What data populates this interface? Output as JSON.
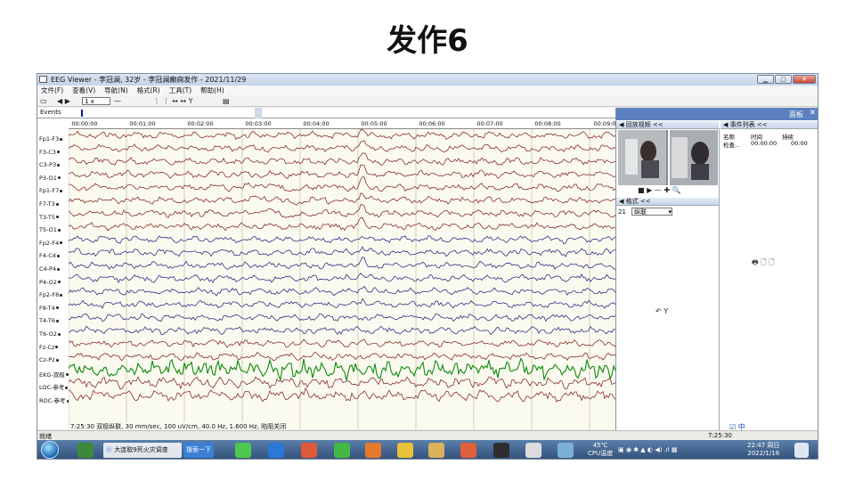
{
  "slide": {
    "title": "发作6"
  },
  "window": {
    "title": "EEG Viewer - 李冠澜, 32岁 - 李冠澜癫痫发作 - 2021/11/29",
    "menu": [
      "文件(F)",
      "查看(V)",
      "导航(N)",
      "格式(R)",
      "工具(T)",
      "帮助(H)"
    ],
    "toolbar": {
      "speed": "1 x",
      "icons": "◀ ▶",
      "tools": "⋮ ⋮ ↔ ↔ Y"
    }
  },
  "events_label": "Events",
  "time_ticks": [
    "00:00:00",
    "00:01:00",
    "00:02:00",
    "00:03:00",
    "00:04:00",
    "00:05:00",
    "00:06:00",
    "00:07:00",
    "00:08:00",
    "00:09:0"
  ],
  "channels": [
    "Fp1-F3",
    "F3-C3",
    "C3-P3",
    "P3-O1",
    "Fp1-F7",
    "F7-T3",
    "T3-T5",
    "T5-O1",
    "Fp2-F4",
    "F4-C4",
    "C4-P4",
    "P4-O2",
    "Fp2-F8",
    "F8-T4",
    "T4-T6",
    "T6-O2",
    "Fz-Cz",
    "Cz-Pz",
    "EKG-双极",
    "LOC-参考",
    "ROC-参考"
  ],
  "trace_info": "7:25:30 双极纵联, 30 mm/sec, 100 uV/cm, 40.0 Hz, 1.600 Hz, 陷阻关闭",
  "right_panel": {
    "header": "面板",
    "close": "✕",
    "video_section": "回放视频 <<",
    "video_controls": "■  ▶  —  ✚  🔍",
    "format_section": "格式 <<",
    "format_number": "21",
    "format_value": "纵联",
    "events_section": "事件列表 <<",
    "event_columns": [
      "名称",
      "时间",
      "持续"
    ],
    "event_row": [
      "检查...",
      "00:00:00",
      "00:00"
    ],
    "icons": "🖶 🗋 🗋",
    "undo": "↶  Y",
    "bottom_icons": "☑ 中"
  },
  "status": {
    "left": "就绪",
    "right": "7:25:30"
  },
  "taskbar": {
    "search_text": "大连取9死火灾调查",
    "search_button": "搜索一下",
    "cpu_temp": "45℃",
    "cpu_label": "CPU温度",
    "clock_time": "22:47 周日",
    "clock_date": "2022/1/16"
  },
  "colors": {
    "red_trace": "#7a1414",
    "blue_trace": "#16167a",
    "ekg_trace": "#0c8a0c",
    "panel_header": "#5c80c0"
  }
}
